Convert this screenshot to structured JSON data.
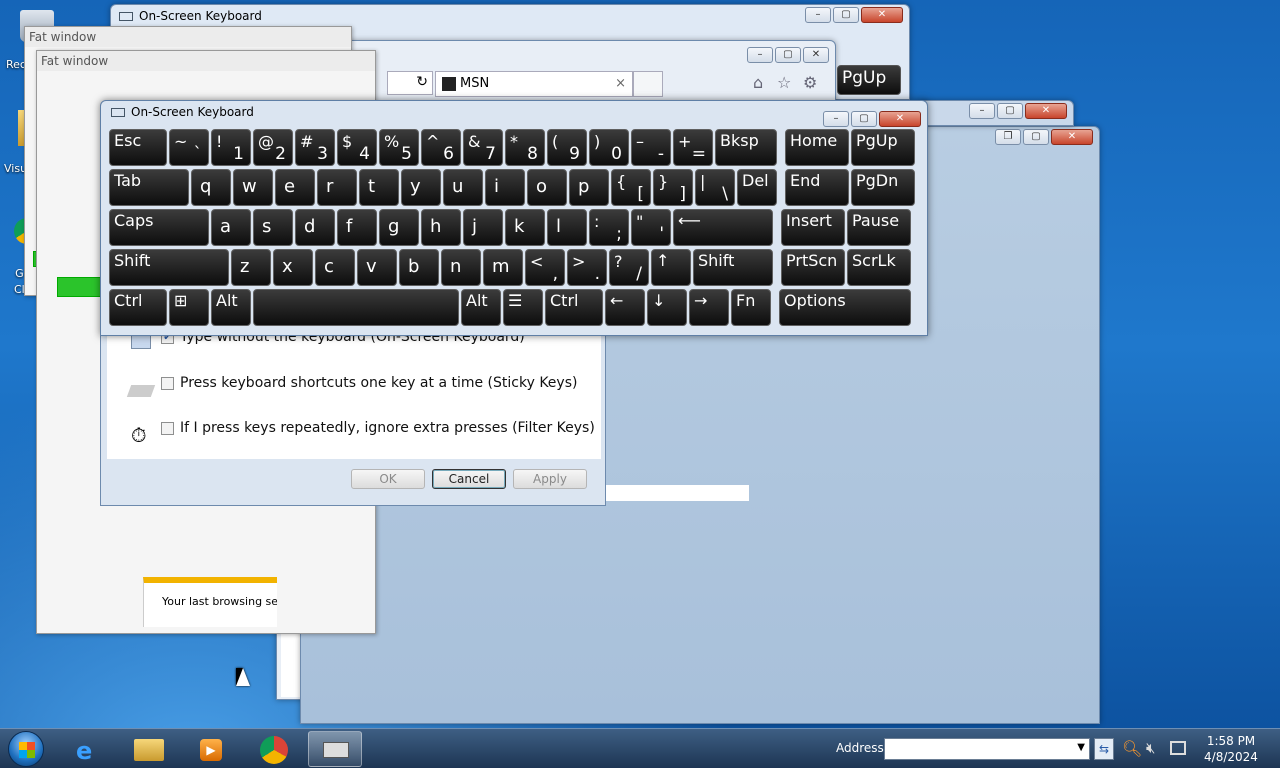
{
  "desktop": {
    "icons": [
      {
        "label": "Rec",
        "icon": "recycle-bin-icon"
      },
      {
        "label": "Visu",
        "icon": "folder-icon"
      },
      {
        "label": "G\nCl",
        "icon": "chrome-icon"
      }
    ]
  },
  "back_osk": {
    "title": "On-Screen Keyboard"
  },
  "fat_windows": [
    {
      "title": "Fat window"
    },
    {
      "title": "Fat window"
    }
  ],
  "browser": {
    "tab_label": "MSN",
    "close_glyph": "×",
    "pgup": "PgUp"
  },
  "notification": {
    "text": "Your last browsing se"
  },
  "osk": {
    "title": "On-Screen Keyboard",
    "rows": [
      [
        {
          "t": "Esc",
          "w": 58
        },
        {
          "t": "~",
          "b": "`",
          "w": 40
        },
        {
          "t": "!",
          "b": "1",
          "w": 40
        },
        {
          "t": "@",
          "b": "2",
          "w": 40
        },
        {
          "t": "#",
          "b": "3",
          "w": 40
        },
        {
          "t": "$",
          "b": "4",
          "w": 40
        },
        {
          "t": "%",
          "b": "5",
          "w": 40
        },
        {
          "t": "^",
          "b": "6",
          "w": 40
        },
        {
          "t": "&",
          "b": "7",
          "w": 40
        },
        {
          "t": "*",
          "b": "8",
          "w": 40
        },
        {
          "t": "(",
          "b": "9",
          "w": 40
        },
        {
          "t": ")",
          "b": "0",
          "w": 40
        },
        {
          "t": "–",
          "b": "-",
          "w": 40
        },
        {
          "t": "+",
          "b": "=",
          "w": 40
        },
        {
          "t": "Bksp",
          "w": 62
        },
        {
          "t": "Home",
          "w": 64,
          "gap": 6
        },
        {
          "t": "PgUp",
          "w": 64
        }
      ],
      [
        {
          "t": "Tab",
          "w": 80
        },
        {
          "m": "q",
          "w": 40
        },
        {
          "m": "w",
          "w": 40
        },
        {
          "m": "e",
          "w": 40
        },
        {
          "m": "r",
          "w": 40
        },
        {
          "m": "t",
          "w": 40
        },
        {
          "m": "y",
          "w": 40
        },
        {
          "m": "u",
          "w": 40
        },
        {
          "m": "i",
          "w": 40
        },
        {
          "m": "o",
          "w": 40
        },
        {
          "m": "p",
          "w": 40
        },
        {
          "t": "{",
          "b": "[",
          "w": 40
        },
        {
          "t": "}",
          "b": "]",
          "w": 40
        },
        {
          "t": "|",
          "b": "\\",
          "w": 40
        },
        {
          "t": "Del",
          "w": 40
        },
        {
          "t": "End",
          "w": 64,
          "gap": 6
        },
        {
          "t": "PgDn",
          "w": 64
        }
      ],
      [
        {
          "t": "Caps",
          "w": 100
        },
        {
          "m": "a",
          "w": 40
        },
        {
          "m": "s",
          "w": 40
        },
        {
          "m": "d",
          "w": 40
        },
        {
          "m": "f",
          "w": 40
        },
        {
          "m": "g",
          "w": 40
        },
        {
          "m": "h",
          "w": 40
        },
        {
          "m": "j",
          "w": 40
        },
        {
          "m": "k",
          "w": 40
        },
        {
          "m": "l",
          "w": 40
        },
        {
          "t": ":",
          "b": ";",
          "w": 40
        },
        {
          "t": "\"",
          "b": "'",
          "w": 40
        },
        {
          "t": "⟵",
          "w": 100
        },
        {
          "t": "Insert",
          "w": 64,
          "gap": 6
        },
        {
          "t": "Pause",
          "w": 64
        }
      ],
      [
        {
          "t": "Shift",
          "w": 120
        },
        {
          "m": "z",
          "w": 40
        },
        {
          "m": "x",
          "w": 40
        },
        {
          "m": "c",
          "w": 40
        },
        {
          "m": "v",
          "w": 40
        },
        {
          "m": "b",
          "w": 40
        },
        {
          "m": "n",
          "w": 40
        },
        {
          "m": "m",
          "w": 40
        },
        {
          "t": "<",
          "b": ",",
          "w": 40
        },
        {
          "t": ">",
          "b": ".",
          "w": 40
        },
        {
          "t": "?",
          "b": "/",
          "w": 40
        },
        {
          "t": "↑",
          "w": 40
        },
        {
          "t": "Shift",
          "w": 80
        },
        {
          "t": "PrtScn",
          "w": 64,
          "gap": 6
        },
        {
          "t": "ScrLk",
          "w": 64
        }
      ],
      [
        {
          "t": "Ctrl",
          "w": 58
        },
        {
          "t": "⊞",
          "w": 40
        },
        {
          "t": "Alt",
          "w": 40
        },
        {
          "t": "",
          "w": 206
        },
        {
          "t": "Alt",
          "w": 40
        },
        {
          "t": "☰",
          "w": 40
        },
        {
          "t": "Ctrl",
          "w": 58
        },
        {
          "t": "←",
          "w": 40
        },
        {
          "t": "↓",
          "w": 40
        },
        {
          "t": "→",
          "w": 40
        },
        {
          "t": "Fn",
          "w": 40
        },
        {
          "t": "Options",
          "w": 132,
          "gap": 6
        }
      ]
    ]
  },
  "dialog": {
    "options": [
      {
        "label": "Type without the keyboard (On-Screen Keyboard)",
        "checked": true
      },
      {
        "label": "Press keyboard shortcuts one key at a time (Sticky Keys)",
        "checked": false
      },
      {
        "label": "If I press keys repeatedly, ignore extra presses (Filter Keys)",
        "checked": false
      }
    ],
    "ok": "OK",
    "cancel": "Cancel",
    "apply": "Apply"
  },
  "taskbar": {
    "address_label": "Address",
    "address_value": "",
    "time": "1:58 PM",
    "date": "4/8/2024"
  }
}
